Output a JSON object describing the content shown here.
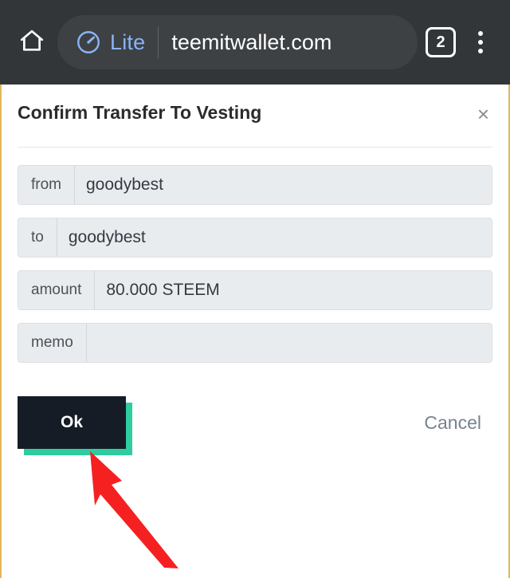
{
  "browser": {
    "home_icon": "home-icon",
    "lite_icon": "speedometer-icon",
    "lite_label": "Lite",
    "url": "teemitwallet.com",
    "tab_count": "2",
    "menu_icon": "more-vertical-icon",
    "chrome_color": "#323639",
    "omnibox_color": "#3d4144",
    "lite_accent": "#8ab4f8"
  },
  "dialog": {
    "title": "Confirm Transfer To Vesting",
    "close_icon": "close-icon",
    "close_label": "×",
    "fields": [
      {
        "label": "from",
        "value": "goodybest"
      },
      {
        "label": "to",
        "value": "goodybest"
      },
      {
        "label": "amount",
        "value": "80.000 STEEM"
      },
      {
        "label": "memo",
        "value": ""
      }
    ],
    "ok_label": "Ok",
    "cancel_label": "Cancel",
    "ok_bg": "#151c26",
    "ok_shadow": "#2ecc9f",
    "cancel_color": "#78838f",
    "page_border": "#e2b85a"
  },
  "annotation": {
    "arrow_color": "#f52121",
    "arrow_name": "red-pointer-arrow",
    "points_to": "Ok"
  }
}
